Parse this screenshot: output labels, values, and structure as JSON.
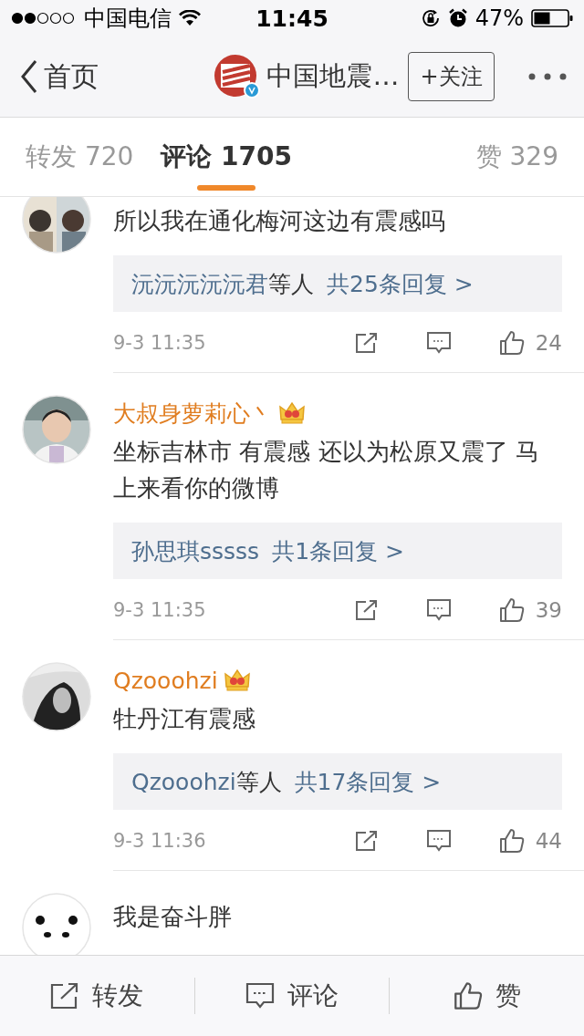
{
  "status_bar": {
    "carrier": "中国电信",
    "time": "11:45",
    "battery": "47%"
  },
  "nav": {
    "back": "首页",
    "account": "中国地震…",
    "follow": "+关注"
  },
  "tabs": [
    {
      "label": "转发 720",
      "selected": false
    },
    {
      "label": "评论 1705",
      "selected": true
    },
    {
      "label": "赞 329",
      "selected": false
    }
  ],
  "comments": [
    {
      "text": "所以我在通化梅河这边有震感吗",
      "reply": {
        "users": "沅沅沅沅沅君",
        "suffix": "等人",
        "count": "共25条回复 >"
      },
      "time": "9-3 11:35",
      "likes": "24"
    },
    {
      "name": "大叔身萝莉心丶",
      "vip": true,
      "text": "坐标吉林市 有震感 还以为松原又震了 马上来看你的微博",
      "reply": {
        "users": "孙思琪sssss",
        "count": "共1条回复 >"
      },
      "time": "9-3 11:35",
      "likes": "39"
    },
    {
      "name": "Qzooohzi",
      "vip": true,
      "text": "牡丹江有震感",
      "reply": {
        "users": "Qzooohzi",
        "suffix": "等人",
        "count": "共17条回复 >"
      },
      "time": "9-3 11:36",
      "likes": "44"
    },
    {
      "text": "我是奋斗胖"
    }
  ],
  "bottom_bar": [
    {
      "kind": "repost",
      "label": "转发"
    },
    {
      "kind": "comment",
      "label": "评论"
    },
    {
      "kind": "like",
      "label": "赞"
    }
  ]
}
